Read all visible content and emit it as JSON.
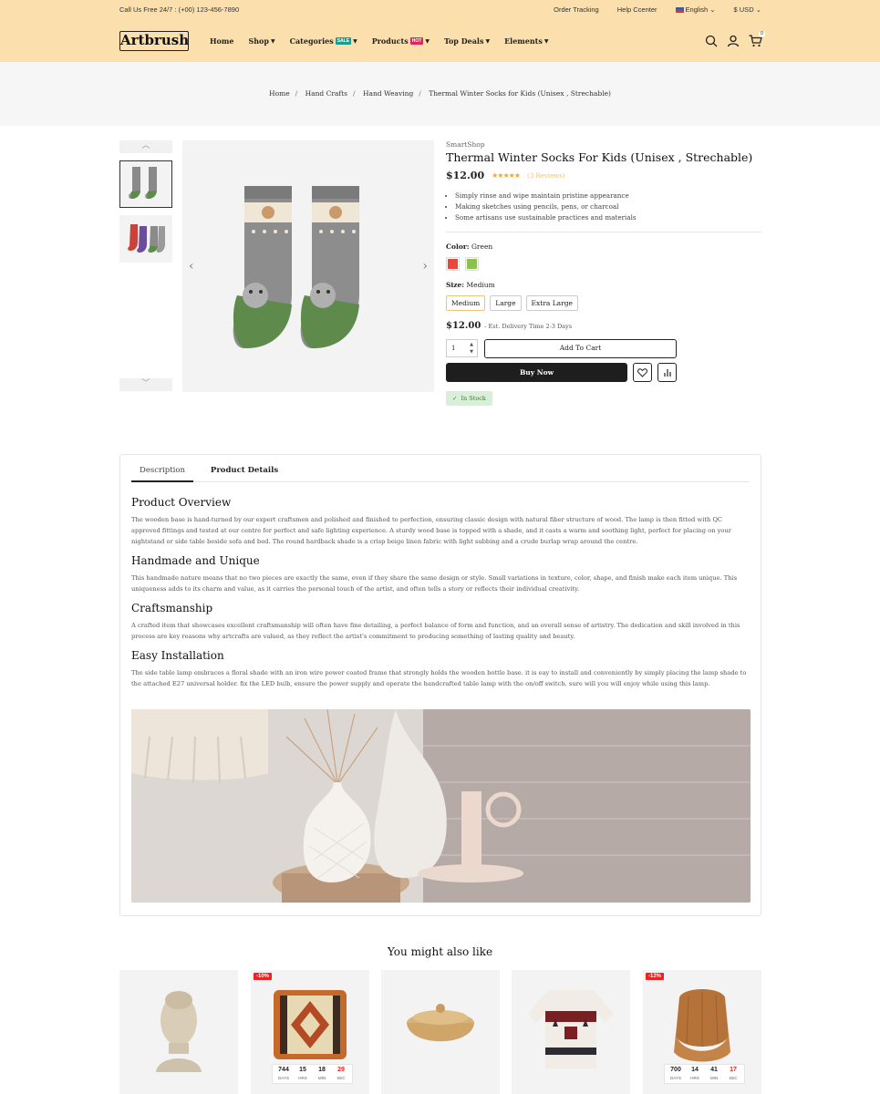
{
  "topbar": {
    "phone": "Call Us Free 24/7 : (+00) 123-456-7890",
    "order_tracking": "Order Tracking",
    "help_center": "Help Ccenter",
    "language": "English",
    "currency": "$ USD"
  },
  "header": {
    "logo": "Artbrush",
    "nav": [
      {
        "label": "Home"
      },
      {
        "label": "Shop"
      },
      {
        "label": "Categories",
        "badge": "SALE",
        "badge_color": "#1a9d8f"
      },
      {
        "label": "Products",
        "badge": "HOT",
        "badge_color": "#e6245c"
      },
      {
        "label": "Top Deals"
      },
      {
        "label": "Elements"
      }
    ],
    "cart_count": "0"
  },
  "breadcrumb": [
    "Home",
    "Hand Crafts",
    "Hand Weaving",
    "Thermal Winter Socks for Kids (Unisex , Strechable)"
  ],
  "product": {
    "brand": "SmartShop",
    "title": "Thermal Winter Socks For Kids (Unisex , Strechable)",
    "price": "$12.00",
    "reviews": "(3 Reviews)",
    "bullets": [
      "Simply rinse and wipe maintain pristine appearance",
      "Making sketches using pencils, pens, or charcoal",
      "Some artisans use sustainable practices and materials"
    ],
    "color_label": "Color:",
    "color_value": "Green",
    "colors": [
      "#e8473a",
      "#8cc152"
    ],
    "size_label": "Size:",
    "size_value": "Medium",
    "sizes": [
      "Medium",
      "Large",
      "Extra Large"
    ],
    "price2": "$12.00",
    "delivery": "- Est. Delivery Time 2-3 Days",
    "qty": "1",
    "add_to_cart": "Add To Cart",
    "buy_now": "Buy Now",
    "stock": "In Stock"
  },
  "tabs": [
    "Description",
    "Product Details"
  ],
  "description": [
    {
      "heading": "Product Overview",
      "text": "The wooden base is hand-turned by our expert craftsmen and polished and finished to perfection, ensuring classic design with natural fiber structure of wood. The lamp is then fitted with QC approved fittings and tested at our centre for perfect and safe lighting experience. A sturdy wood base is topped with a shade, and it casts a warm and soothing light, perfect for placing on your nightstand or side table beside sofa and bed. The round hardback shade is a crisp beige linen fabric with light subbing and a crude burlap wrap around the centre."
    },
    {
      "heading": "Handmade and Unique",
      "text": "This handmade nature means that no two pieces are exactly the same, even if they share the same design or style. Small variations in texture, color, shape, and finish make each item unique. This uniqueness adds to its charm and value, as it carries the personal touch of the artist, and often tells a story or reflects their individual creativity."
    },
    {
      "heading": "Craftsmanship",
      "text": "A crafted item that showcases excellent craftsmanship will often have fine detailing, a perfect balance of form and function, and an overall sense of artistry. The dedication and skill involved in this process are key reasons why artcrafts are valued, as they reflect the artist's commitment to producing something of lasting quality and beauty."
    },
    {
      "heading": "Easy Installation",
      "text": "The side table lamp embraces a floral shade with an iron wire power coated frame that strongly holds the wooden bottle base. it is eay to install and conveniently by simply placing the lamp shade to the attached E27 universal holder. fix the LED bulb, ensure the power supply and operate the handcrafted table lamp with the on/off switch. sure will you will enjoy while using this lamp."
    }
  ],
  "related": {
    "title": "You might also like",
    "cards": [
      {
        "discount": ""
      },
      {
        "discount": "-10%",
        "timer": [
          "744",
          "15",
          "18",
          "29"
        ]
      },
      {
        "discount": ""
      },
      {
        "discount": ""
      },
      {
        "discount": "-12%",
        "timer": [
          "700",
          "14",
          "41",
          "17"
        ]
      }
    ],
    "timer_units": [
      "DAYS",
      "HRS",
      "MIN",
      "SEC"
    ]
  }
}
